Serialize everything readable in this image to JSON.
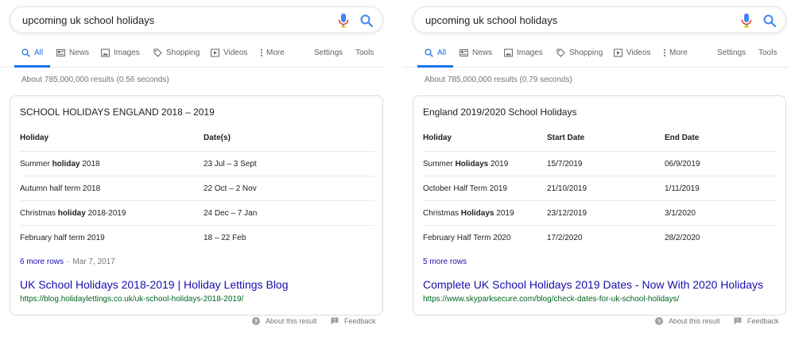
{
  "colors": {
    "accent": "#1a73e8",
    "link": "#1a0dab",
    "url": "#006621",
    "muted": "#70757a"
  },
  "panels": [
    {
      "search": {
        "query": "upcoming uk school holidays"
      },
      "tabs": [
        {
          "label": "All",
          "icon": "search-icon",
          "active": true
        },
        {
          "label": "News",
          "icon": "news-icon"
        },
        {
          "label": "Images",
          "icon": "image-icon"
        },
        {
          "label": "Shopping",
          "icon": "tag-icon"
        },
        {
          "label": "Videos",
          "icon": "video-icon"
        },
        {
          "label": "More",
          "icon": "more-vert-icon"
        },
        {
          "label": "Settings"
        },
        {
          "label": "Tools"
        }
      ],
      "stats": "About 785,000,000 results (0.56 seconds)",
      "card": {
        "title": "SCHOOL HOLIDAYS ENGLAND 2018 – 2019",
        "headers": [
          "Holiday",
          "Date(s)"
        ],
        "rows": [
          {
            "holiday_pre": "Summer ",
            "holiday_bold": "holiday",
            "holiday_post": " 2018",
            "c1": "23 Jul – 3 Sept"
          },
          {
            "holiday_pre": "Autumn half term 2018",
            "holiday_bold": "",
            "holiday_post": "",
            "c1": "22 Oct – 2 Nov"
          },
          {
            "holiday_pre": "Christmas ",
            "holiday_bold": "holiday",
            "holiday_post": " 2018-2019",
            "c1": "24 Dec – 7 Jan"
          },
          {
            "holiday_pre": "February half term 2019",
            "holiday_bold": "",
            "holiday_post": "",
            "c1": "18 – 22 Feb"
          }
        ],
        "more_rows": "6 more rows",
        "separator": "·",
        "date": "Mar 7, 2017",
        "result_title": "UK School Holidays 2018-2019 | Holiday Lettings Blog",
        "result_url": "https://blog.holidaylettings.co.uk/uk-school-holidays-2018-2019/"
      },
      "footer": {
        "about": "About this result",
        "feedback": "Feedback"
      }
    },
    {
      "search": {
        "query": "upcoming uk school holidays"
      },
      "tabs": [
        {
          "label": "All",
          "icon": "search-icon",
          "active": true
        },
        {
          "label": "News",
          "icon": "news-icon"
        },
        {
          "label": "Images",
          "icon": "image-icon"
        },
        {
          "label": "Shopping",
          "icon": "tag-icon"
        },
        {
          "label": "Videos",
          "icon": "video-icon"
        },
        {
          "label": "More",
          "icon": "more-vert-icon"
        },
        {
          "label": "Settings"
        },
        {
          "label": "Tools"
        }
      ],
      "stats": "About 785,000,000 results (0.79 seconds)",
      "card": {
        "title": "England 2019/2020 School Holidays",
        "headers": [
          "Holiday",
          "Start Date",
          "End Date"
        ],
        "rows": [
          {
            "holiday_pre": "Summer ",
            "holiday_bold": "Holidays",
            "holiday_post": " 2019",
            "c1": "15/7/2019",
            "c2": "06/9/2019"
          },
          {
            "holiday_pre": "October Half Term 2019",
            "holiday_bold": "",
            "holiday_post": "",
            "c1": "21/10/2019",
            "c2": "1/11/2019"
          },
          {
            "holiday_pre": "Christmas ",
            "holiday_bold": "Holidays",
            "holiday_post": " 2019",
            "c1": "23/12/2019",
            "c2": "3/1/2020"
          },
          {
            "holiday_pre": "February Half Term 2020",
            "holiday_bold": "",
            "holiday_post": "",
            "c1": "17/2/2020",
            "c2": "28/2/2020"
          }
        ],
        "more_rows": "5 more rows",
        "result_title": "Complete UK School Holidays 2019 Dates - Now With 2020 Holidays",
        "result_url": "https://www.skyparksecure.com/blog/check-dates-for-uk-school-holidays/"
      },
      "footer": {
        "about": "About this result",
        "feedback": "Feedback"
      }
    }
  ]
}
